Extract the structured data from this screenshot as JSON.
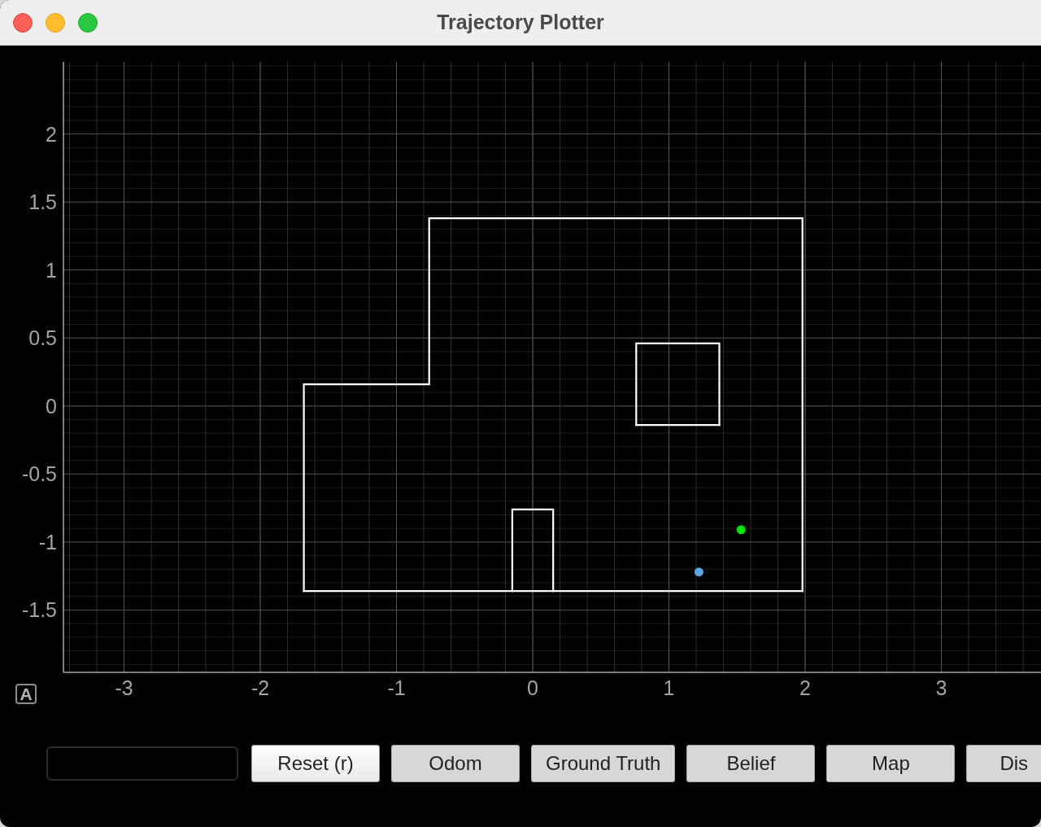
{
  "window": {
    "title": "Trajectory Plotter"
  },
  "plot": {
    "autorange_button": {
      "label": "A"
    },
    "chart_data": {
      "type": "line",
      "grid": true,
      "xlim": [
        -3.445,
        3.731
      ],
      "ylim": [
        -1.958,
        2.53
      ],
      "xticks": [
        -3,
        -2,
        -1,
        0,
        1,
        2,
        3
      ],
      "yticks": [
        2,
        1.5,
        1,
        0.5,
        0,
        -0.5,
        -1,
        -1.5
      ],
      "series": [
        {
          "color": "#ffffff",
          "x": [
            -1.68,
            -1.68,
            -0.76,
            -0.76,
            1.98,
            1.98
          ],
          "values": [
            -1.36,
            0.16,
            0.16,
            1.38,
            1.38,
            -1.36
          ]
        },
        {
          "color": "#ffffff",
          "x": [
            -1.68,
            1.98
          ],
          "values": [
            -1.36,
            -1.36
          ]
        },
        {
          "color": "#ffffff",
          "x": [
            0.76,
            0.76,
            1.37,
            1.37
          ],
          "values": [
            -0.14,
            0.46,
            0.46,
            -0.14
          ]
        },
        {
          "color": "#ffffff",
          "x": [
            0.76,
            1.37
          ],
          "values": [
            -0.14,
            -0.14
          ]
        },
        {
          "color": "#ffffff",
          "x": [
            -0.15,
            -0.15,
            0.15,
            0.15
          ],
          "values": [
            -1.36,
            -0.76,
            -0.76,
            -1.36
          ]
        },
        {
          "color": "#00e600",
          "marker": "circle",
          "x": [
            1.53
          ],
          "values": [
            -0.91
          ]
        },
        {
          "color": "#5da6e4",
          "marker": "circle",
          "x": [
            1.22
          ],
          "values": [
            -1.22
          ]
        }
      ]
    }
  },
  "controls": {
    "buttons": [
      {
        "label": "Reset (r)",
        "default": true
      },
      {
        "label": "Odom",
        "default": false
      },
      {
        "label": "Ground Truth",
        "default": false
      },
      {
        "label": "Belief",
        "default": false
      },
      {
        "label": "Map",
        "default": false
      },
      {
        "label": "Dis",
        "default": false
      }
    ]
  }
}
